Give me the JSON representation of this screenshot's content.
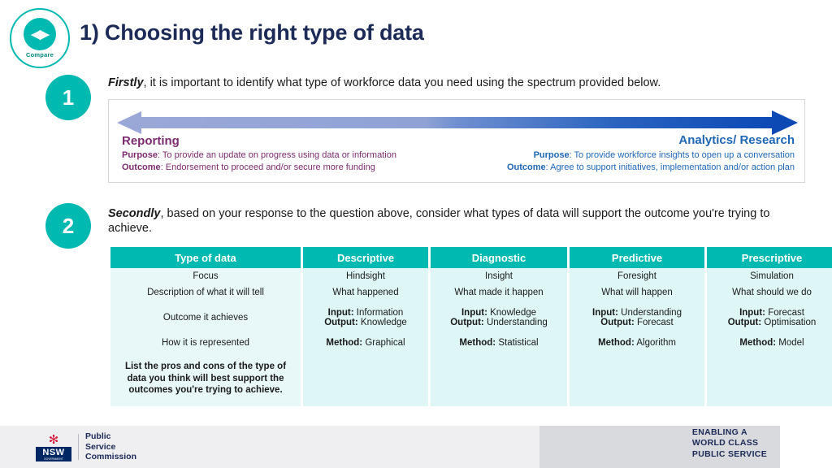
{
  "logo": {
    "glyph": "◀▶",
    "word": "Compare"
  },
  "header": {
    "title": "1) Choosing the right type of data"
  },
  "steps": {
    "one": "1",
    "two": "2"
  },
  "paragraphs": {
    "first_lead": "Firstly",
    "first_rest": ", it is important to identify what type of workforce data you need using the spectrum provided below.",
    "second_lead": "Secondly",
    "second_rest": ", based on your response to the question above, consider what types of data will support the outcome you're trying to achieve."
  },
  "spectrum": {
    "left": {
      "title": "Reporting",
      "purpose_label": "Purpose",
      "purpose_text": ": To provide an update on progress using data or information",
      "outcome_label": "Outcome",
      "outcome_text": ": Endorsement to proceed and/or secure more funding",
      "color": "#7b2b6e"
    },
    "right": {
      "title": "Analytics/ Research",
      "purpose_label": "Purpose",
      "purpose_text": ": To provide workforce insights to open up a conversation",
      "outcome_label": "Outcome",
      "outcome_text": ": Agree to support initiatives, implementation and/or action plan",
      "color": "#1f66b5"
    }
  },
  "table": {
    "headers": [
      "Type of data",
      "Descriptive",
      "Diagnostic",
      "Predictive",
      "Prescriptive"
    ],
    "rows": [
      {
        "label": "Focus",
        "cells": [
          "Hindsight",
          "Insight",
          "Foresight",
          "Simulation"
        ]
      },
      {
        "label": "Description of what it will tell",
        "cells": [
          "What happened",
          "What made it happen",
          "What will happen",
          "What should we do"
        ]
      },
      {
        "label": "Outcome it achieves",
        "cells_rich": [
          {
            "l1_label": "Input:",
            "l1_text": " Information",
            "l2_label": "Output:",
            "l2_text": " Knowledge"
          },
          {
            "l1_label": "Input:",
            "l1_text": " Knowledge",
            "l2_label": "Output:",
            "l2_text": " Understanding"
          },
          {
            "l1_label": "Input:",
            "l1_text": " Understanding",
            "l2_label": "Output:",
            "l2_text": " Forecast"
          },
          {
            "l1_label": "Input:",
            "l1_text": " Forecast",
            "l2_label": "Output:",
            "l2_text": " Optimisation"
          }
        ]
      },
      {
        "label": "How it is represented",
        "cells_rich": [
          {
            "l1_label": "Method:",
            "l1_text": " Graphical"
          },
          {
            "l1_label": "Method:",
            "l1_text": " Statistical"
          },
          {
            "l1_label": "Method:",
            "l1_text": " Algorithm"
          },
          {
            "l1_label": "Method:",
            "l1_text": " Model"
          }
        ]
      }
    ],
    "prompt": "List the pros and cons of the type of data you think will best support the outcomes you're trying to achieve",
    "prompt_tail": "."
  },
  "footer": {
    "nsw_mark_text": "NSW",
    "nsw_mark_sub": "GOVERNMENT",
    "org_line1": "Public",
    "org_line2": "Service",
    "org_line3": "Commission",
    "slogan_line1": "ENABLING A",
    "slogan_line2": "WORLD CLASS",
    "slogan_line3": "PUBLIC SERVICE"
  },
  "colors": {
    "teal": "#00b9b0",
    "navy": "#1b2a56",
    "purple": "#7b2b6e",
    "blue": "#1f66b5",
    "table_cell": "#dff6f7"
  }
}
